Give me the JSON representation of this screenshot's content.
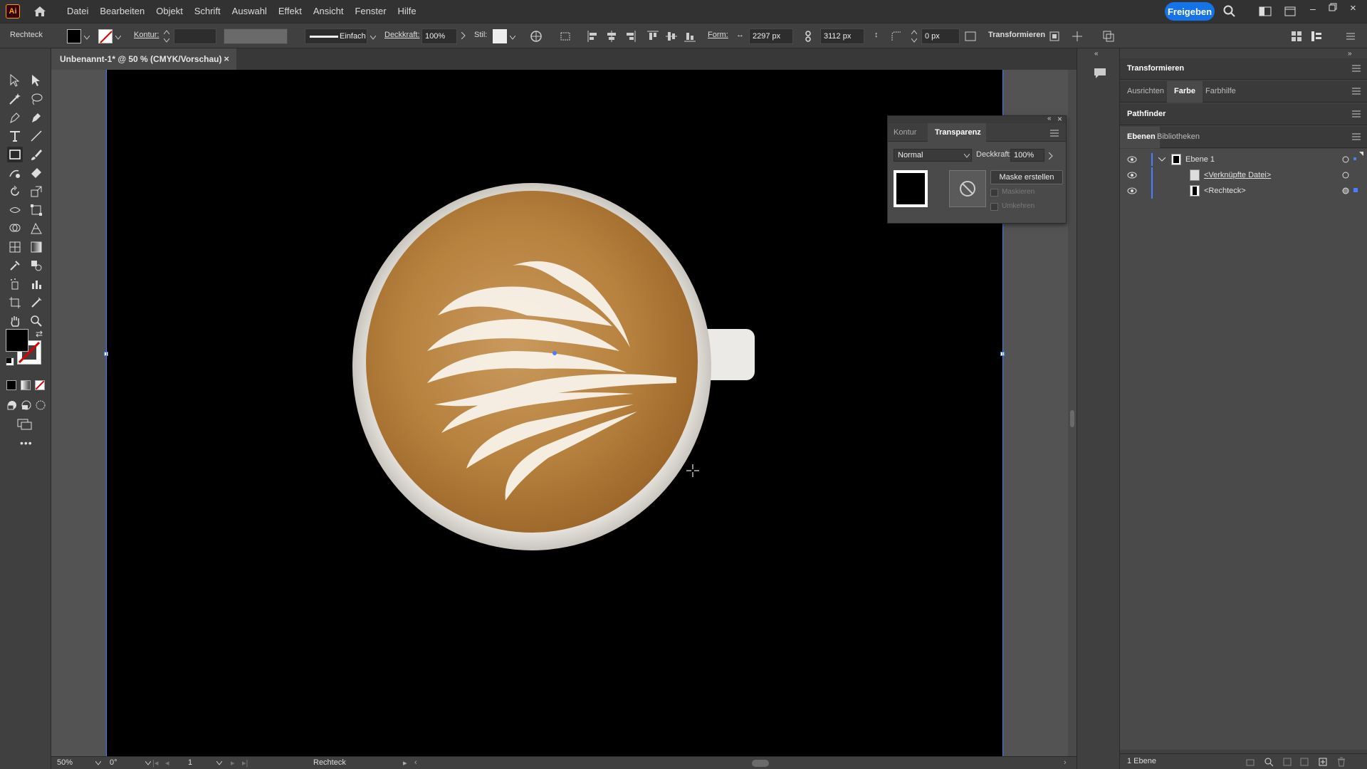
{
  "app": {
    "logo": "Ai",
    "share_label": "Freigeben"
  },
  "menu": [
    "Datei",
    "Bearbeiten",
    "Objekt",
    "Schrift",
    "Auswahl",
    "Effekt",
    "Ansicht",
    "Fenster",
    "Hilfe"
  ],
  "controlbar": {
    "object_type": "Rechteck",
    "stroke_label": "Kontur:",
    "stroke_style": "Einfach",
    "opacity_label": "Deckkraft:",
    "opacity_value": "100%",
    "style_label": "Stil:",
    "shape_label": "Form:",
    "width_value": "2297 px",
    "height_value": "3112 px",
    "corner_value": "0 px",
    "transform_label": "Transformieren"
  },
  "document_tab": {
    "title": "Unbenannt-1* @ 50 % (CMYK/Vorschau)",
    "close": "×"
  },
  "transparency_panel": {
    "tabs": [
      "Kontur",
      "Transparenz"
    ],
    "blend_mode": "Normal",
    "opacity_label": "Deckkraft:",
    "opacity_value": "100%",
    "make_mask_label": "Maske erstellen",
    "clip_label": "Maskieren",
    "invert_label": "Umkehren"
  },
  "right_panels": {
    "transform_title": "Transformieren",
    "tabs_row1": [
      "Ausrichten",
      "Farbe",
      "Farbhilfe"
    ],
    "pathfinder_title": "Pathfinder",
    "tabs_row2": [
      "Ebenen",
      "Bibliotheken"
    ],
    "layers": [
      {
        "name": "Ebene 1"
      },
      {
        "name": "<Verknüpfte Datei>"
      },
      {
        "name": "<Rechteck>"
      }
    ],
    "layer_count": "1 Ebene"
  },
  "statusbar": {
    "zoom": "50%",
    "rotation": "0°",
    "artboard_number": "1",
    "tool_name": "Rechteck"
  },
  "colors": {
    "accent": "#1473e6",
    "layer_blue": "#4a7dff",
    "canvas_bg": "#000000",
    "panel_bg": "#404040"
  }
}
